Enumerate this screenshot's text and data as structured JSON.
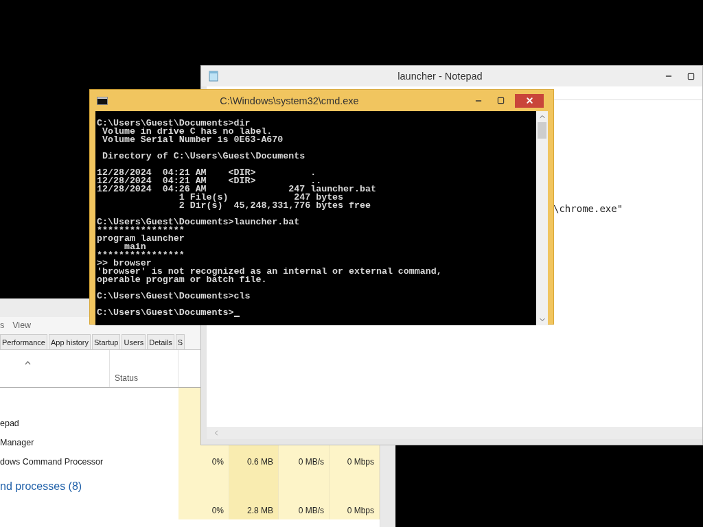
{
  "task_manager": {
    "menu": [
      "s",
      "View"
    ],
    "tabs": [
      {
        "label": "Performance",
        "selected": false
      },
      {
        "label": "App history",
        "selected": false
      },
      {
        "label": "Startup",
        "selected": false
      },
      {
        "label": "Users",
        "selected": false
      },
      {
        "label": "Details",
        "selected": false
      },
      {
        "label": "S",
        "selected": false
      }
    ],
    "columns": [
      "Status"
    ],
    "rows": [
      {
        "kind": "process",
        "name": "epad"
      },
      {
        "kind": "process",
        "name": "Manager"
      },
      {
        "kind": "process",
        "name": "dows Command Processor",
        "cpu": "0%",
        "memory": "0.6 MB",
        "disk": "0 MB/s",
        "network": "0 Mbps"
      },
      {
        "kind": "group",
        "name": "nd processes (8)"
      },
      {
        "kind": "process",
        "cpu": "0%",
        "memory": "2.8 MB",
        "disk": "0 MB/s",
        "network": "0 Mbps"
      }
    ]
  },
  "notepad": {
    "title": "launcher - Notepad",
    "lines": [
      "\\chrome.exe\""
    ]
  },
  "cmd": {
    "title": "C:\\Windows\\system32\\cmd.exe",
    "blocks": [
      [
        "C:\\Users\\Guest\\Documents>dir",
        " Volume in drive C has no label.",
        " Volume Serial Number is 0E63-A670"
      ],
      [
        " Directory of C:\\Users\\Guest\\Documents"
      ],
      [
        "12/28/2024  04:21 AM    <DIR>          .",
        "12/28/2024  04:21 AM    <DIR>          ..",
        "12/28/2024  04:26 AM               247 launcher.bat",
        "               1 File(s)            247 bytes",
        "               2 Dir(s)  45,248,331,776 bytes free"
      ],
      [
        "C:\\Users\\Guest\\Documents>launcher.bat",
        "****************",
        "program launcher",
        "     main",
        "****************",
        ">> browser",
        "'browser' is not recognized as an internal or external command,",
        "operable program or batch file."
      ],
      [
        "C:\\Users\\Guest\\Documents>cls"
      ],
      [
        "C:\\Users\\Guest\\Documents>"
      ]
    ]
  }
}
